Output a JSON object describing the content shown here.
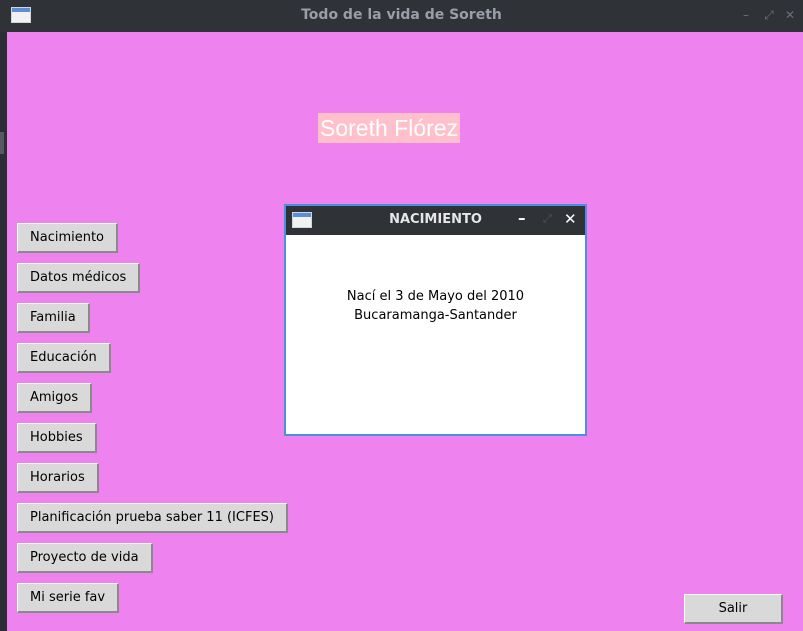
{
  "window": {
    "title": "Todo de la vida de Soreth"
  },
  "header": {
    "name": "Soreth Flórez"
  },
  "menu": [
    {
      "label": "Nacimiento"
    },
    {
      "label": "Datos médicos"
    },
    {
      "label": "Familia"
    },
    {
      "label": "Educación"
    },
    {
      "label": "Amigos"
    },
    {
      "label": "Hobbies"
    },
    {
      "label": "Horarios"
    },
    {
      "label": "Planificación prueba saber 11 (ICFES)"
    },
    {
      "label": "Proyecto de vida"
    },
    {
      "label": "Mi serie fav"
    }
  ],
  "exit_label": "Salir",
  "popup": {
    "title": "NACIMIENTO",
    "lines": [
      "Nací el 3 de Mayo del 2010",
      "Bucaramanga-Santander"
    ]
  },
  "colors": {
    "background": "#ee82ee",
    "name_label_bg": "#ffc0cb",
    "titlebar": "#2f3237",
    "popup_border": "#4a90e2"
  },
  "icons": {
    "app": "window-app-icon",
    "minimize": "minimize-icon",
    "maximize": "maximize-icon",
    "close": "close-icon"
  }
}
